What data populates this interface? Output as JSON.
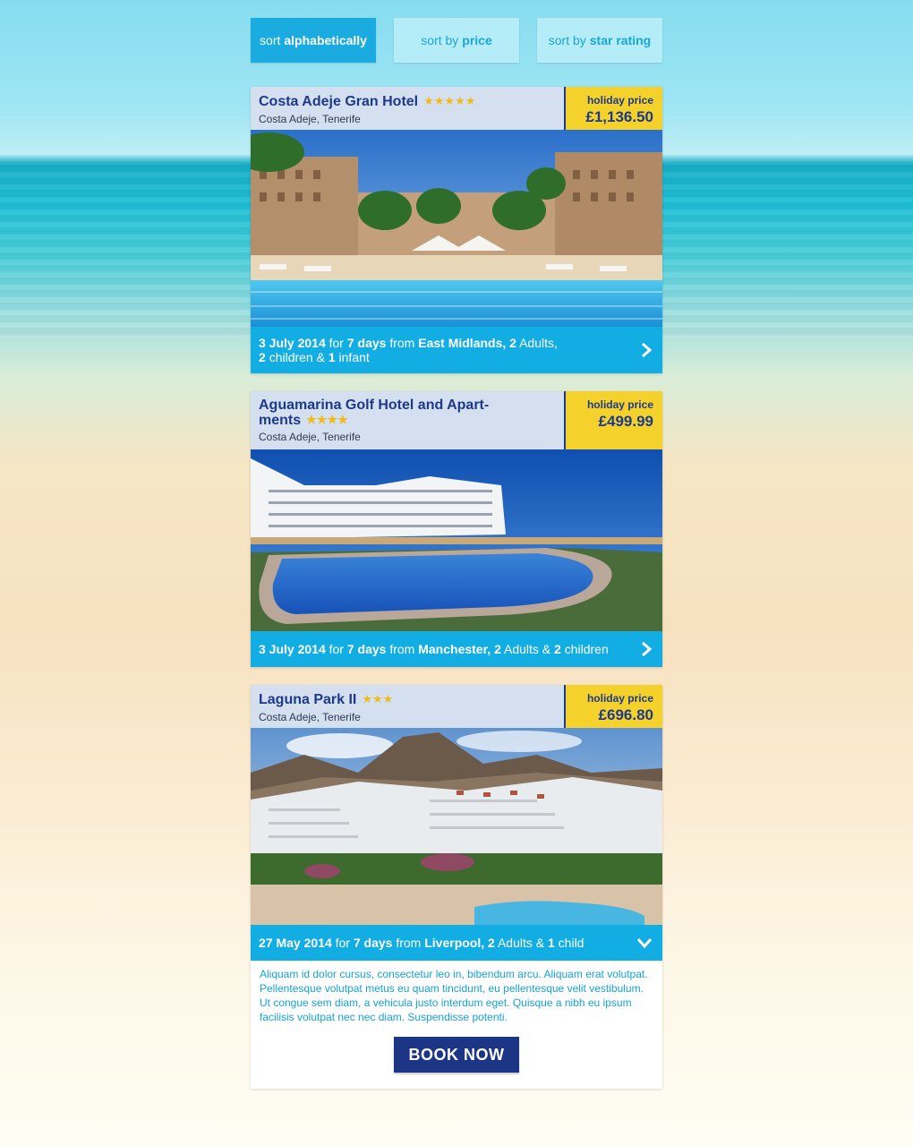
{
  "sort": {
    "alpha": {
      "prefix": "sort",
      "bold": "alphabetically"
    },
    "price": {
      "prefix": "sort by",
      "bold": "price"
    },
    "star": {
      "prefix": "sort by",
      "bold": "star rating"
    }
  },
  "hotels": [
    {
      "name": "Costa Adeje Gran Hotel",
      "stars": "★★★★★",
      "location": "Costa Adeje, Tenerife",
      "price_label": "holiday price",
      "price": "£1,136.50",
      "date": "3 July 2014",
      "w_for": "for",
      "duration": "7 days",
      "w_from": "from",
      "departure": "East Midlands,",
      "adults_n": "2",
      "adults_w": "Adults,",
      "children_n": "2",
      "children_w": "children &",
      "infant_n": "1",
      "infant_w": "infant"
    },
    {
      "name_line1": "Aguamarina Golf Hotel and Apart-",
      "name_line2": "ments",
      "stars": "★★★★",
      "location": "Costa Adeje, Tenerife",
      "price_label": "holiday price",
      "price": "£499.99",
      "date": "3 July 2014",
      "w_for": "for",
      "duration": "7 days",
      "w_from": "from",
      "departure": "Manchester,",
      "adults_n": "2",
      "adults_w": "Adults &",
      "children_n": "2",
      "children_w": "children"
    },
    {
      "name": "Laguna Park II",
      "stars": "★★★",
      "location": "Costa Adeje, Tenerife",
      "price_label": "holiday price",
      "price": "£696.80",
      "date": "27 May 2014",
      "w_for": "for",
      "duration": "7 days",
      "w_from": "from",
      "departure": "Liverpool,",
      "adults_n": "2",
      "adults_w": "Adults &",
      "child_n": "1",
      "child_w": "child",
      "description": "Aliquam id dolor cursus, consectetur leo in, bibendum arcu. Aliquam erat volutpat. Pellentesque volutpat metus eu quam tincidunt, eu pellentesque velit vestibulum. Ut congue sem diam, a vehicula justo interdum eget. Quisque a nibh eu ipsum facilisis volutpat nec nec diam. Suspendisse potenti.",
      "book_label": "BOOK NOW"
    }
  ],
  "colors": {
    "accent": "#12aee3",
    "navy": "#1d3a8a",
    "price_bg": "#f5d22b",
    "header_bg": "#d4dff0"
  }
}
